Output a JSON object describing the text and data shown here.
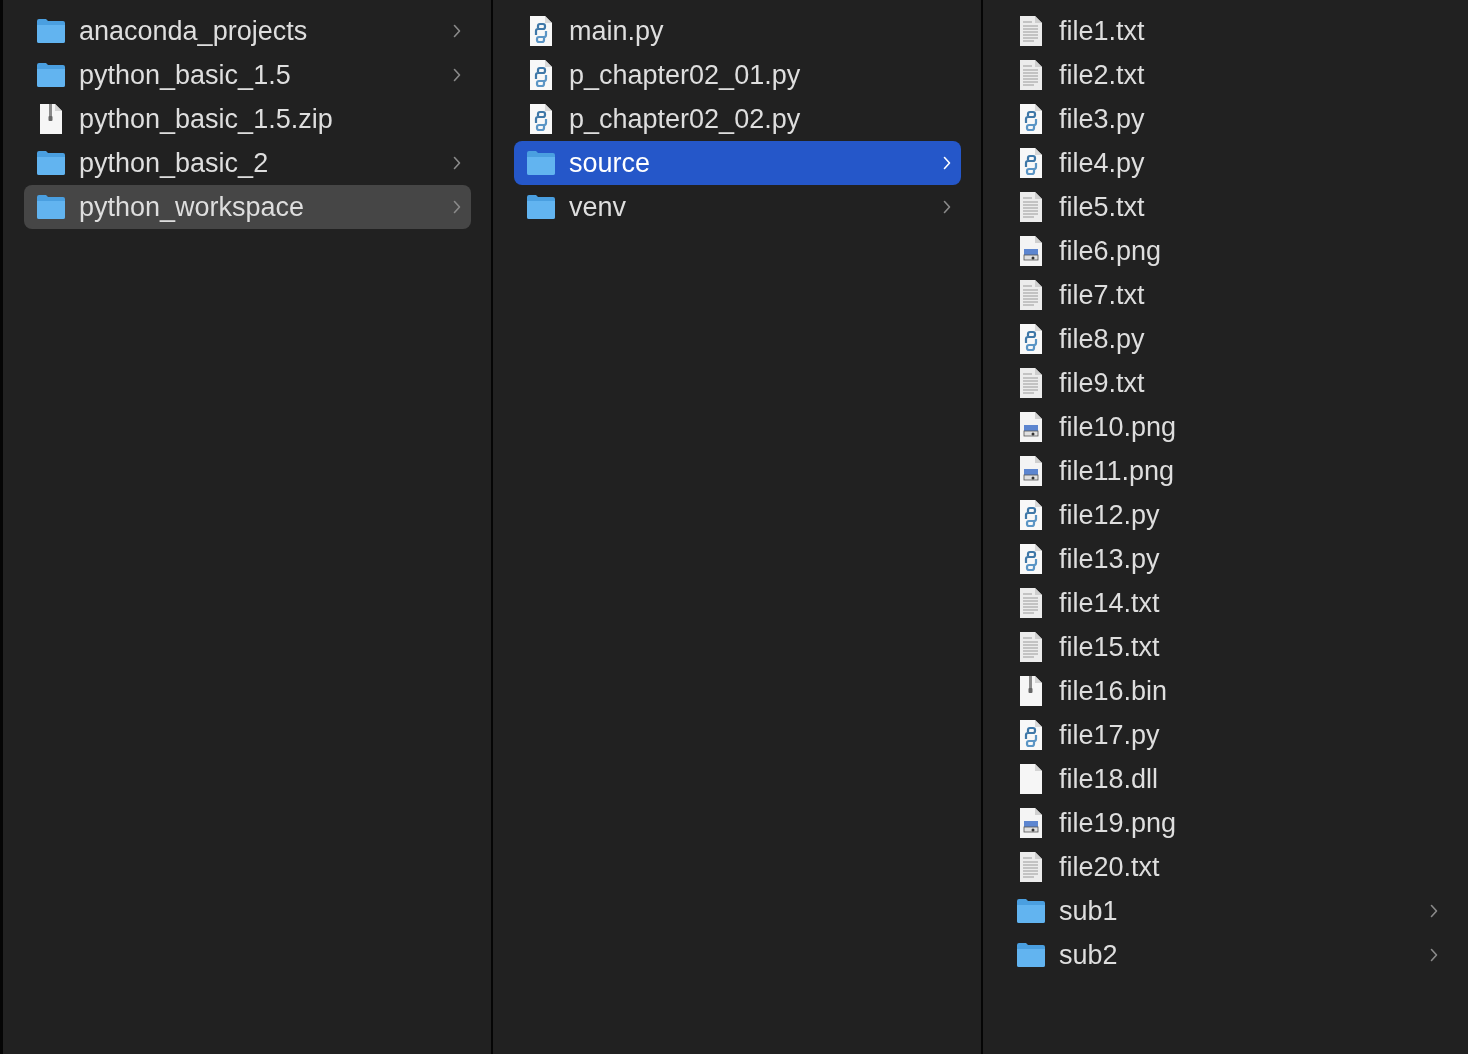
{
  "columns": [
    {
      "focused": false,
      "items": [
        {
          "name": "anaconda_projects",
          "kind": "folder",
          "has_children": true,
          "selected": false
        },
        {
          "name": "python_basic_1.5",
          "kind": "folder",
          "has_children": true,
          "selected": false
        },
        {
          "name": "python_basic_1.5.zip",
          "kind": "zip",
          "has_children": false,
          "selected": false
        },
        {
          "name": "python_basic_2",
          "kind": "folder",
          "has_children": true,
          "selected": false
        },
        {
          "name": "python_workspace",
          "kind": "folder",
          "has_children": true,
          "selected": true
        }
      ]
    },
    {
      "focused": true,
      "items": [
        {
          "name": "main.py",
          "kind": "python",
          "has_children": false,
          "selected": false
        },
        {
          "name": "p_chapter02_01.py",
          "kind": "python",
          "has_children": false,
          "selected": false
        },
        {
          "name": "p_chapter02_02.py",
          "kind": "python",
          "has_children": false,
          "selected": false
        },
        {
          "name": "source",
          "kind": "folder",
          "has_children": true,
          "selected": true
        },
        {
          "name": "venv",
          "kind": "folder",
          "has_children": true,
          "selected": false
        }
      ]
    },
    {
      "items": [
        {
          "name": "file1.txt",
          "kind": "text",
          "has_children": false,
          "selected": false
        },
        {
          "name": "file2.txt",
          "kind": "text",
          "has_children": false,
          "selected": false
        },
        {
          "name": "file3.py",
          "kind": "python",
          "has_children": false,
          "selected": false
        },
        {
          "name": "file4.py",
          "kind": "python",
          "has_children": false,
          "selected": false
        },
        {
          "name": "file5.txt",
          "kind": "text",
          "has_children": false,
          "selected": false
        },
        {
          "name": "file6.png",
          "kind": "image",
          "has_children": false,
          "selected": false
        },
        {
          "name": "file7.txt",
          "kind": "text",
          "has_children": false,
          "selected": false
        },
        {
          "name": "file8.py",
          "kind": "python",
          "has_children": false,
          "selected": false
        },
        {
          "name": "file9.txt",
          "kind": "text",
          "has_children": false,
          "selected": false
        },
        {
          "name": "file10.png",
          "kind": "image",
          "has_children": false,
          "selected": false
        },
        {
          "name": "file11.png",
          "kind": "image",
          "has_children": false,
          "selected": false
        },
        {
          "name": "file12.py",
          "kind": "python",
          "has_children": false,
          "selected": false
        },
        {
          "name": "file13.py",
          "kind": "python",
          "has_children": false,
          "selected": false
        },
        {
          "name": "file14.txt",
          "kind": "text",
          "has_children": false,
          "selected": false
        },
        {
          "name": "file15.txt",
          "kind": "text",
          "has_children": false,
          "selected": false
        },
        {
          "name": "file16.bin",
          "kind": "zip",
          "has_children": false,
          "selected": false
        },
        {
          "name": "file17.py",
          "kind": "python",
          "has_children": false,
          "selected": false
        },
        {
          "name": "file18.dll",
          "kind": "blank",
          "has_children": false,
          "selected": false
        },
        {
          "name": "file19.png",
          "kind": "image",
          "has_children": false,
          "selected": false
        },
        {
          "name": "file20.txt",
          "kind": "text",
          "has_children": false,
          "selected": false
        },
        {
          "name": "sub1",
          "kind": "folder",
          "has_children": true,
          "selected": false
        },
        {
          "name": "sub2",
          "kind": "folder",
          "has_children": true,
          "selected": false
        }
      ]
    }
  ]
}
